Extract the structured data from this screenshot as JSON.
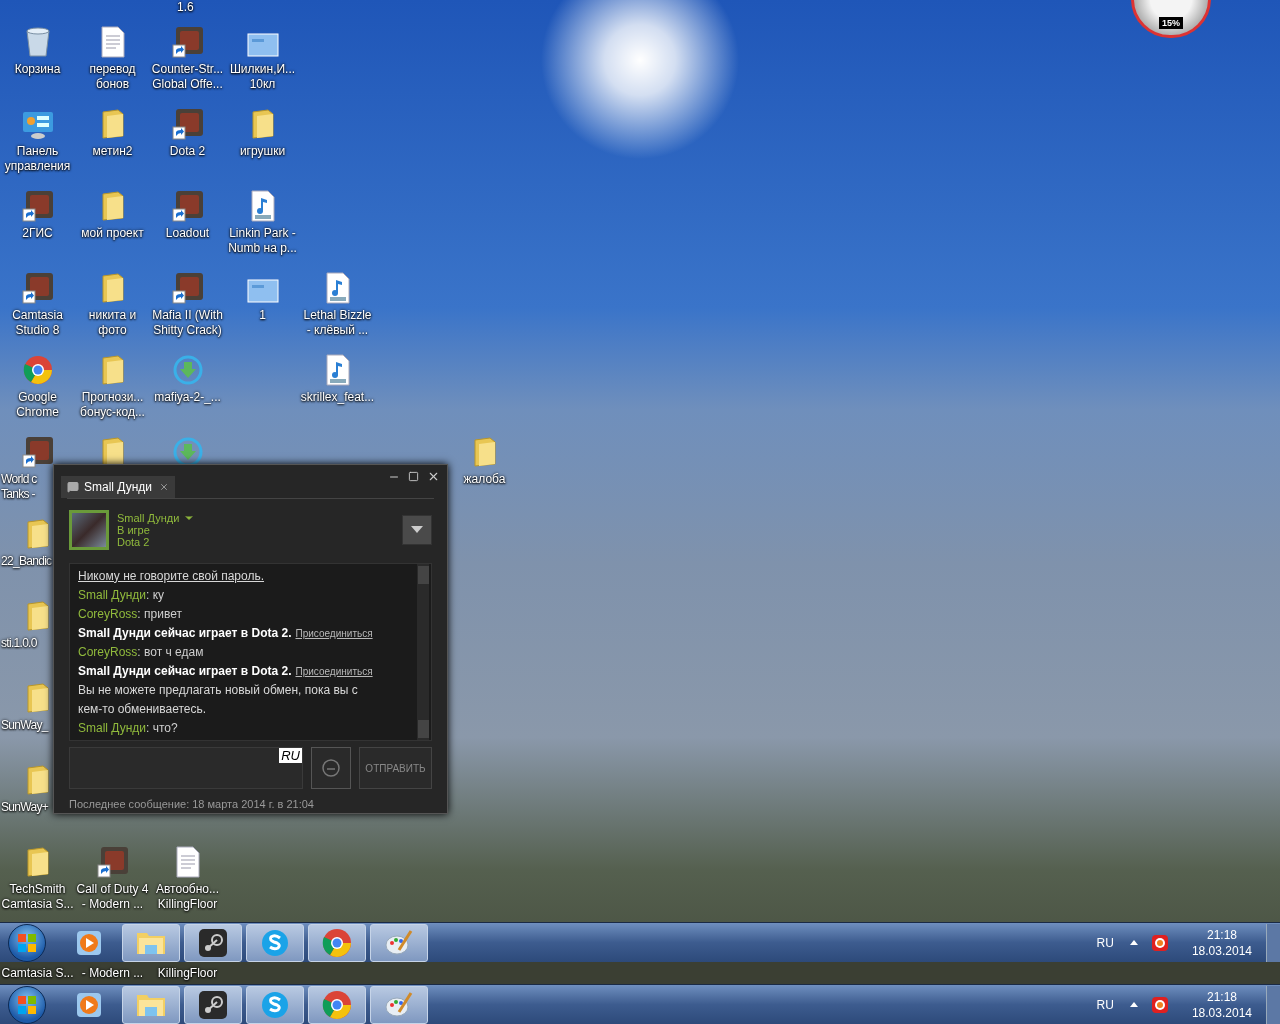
{
  "top_partial_label": "1.6",
  "gadget": {
    "reading": "15%"
  },
  "desktop_columns": [
    {
      "icons": [
        {
          "kind": "recycle",
          "lines": [
            "Корзина"
          ]
        },
        {
          "kind": "control",
          "lines": [
            "Панель",
            "управления"
          ]
        },
        {
          "kind": "app",
          "lines": [
            "2ГИС"
          ]
        },
        {
          "kind": "app",
          "lines": [
            "Camtasia",
            "Studio 8"
          ]
        },
        {
          "kind": "chrome",
          "lines": [
            "Google",
            "Chrome"
          ]
        },
        {
          "kind": "app",
          "lines": [
            "World c",
            "Tanks -"
          ]
        },
        {
          "kind": "folder",
          "lines": [
            "22_Bandic"
          ]
        },
        {
          "kind": "folder",
          "lines": [
            "sti.1.0.0"
          ]
        },
        {
          "kind": "folder",
          "lines": [
            "SunWay_"
          ]
        },
        {
          "kind": "folder",
          "lines": [
            "SunWay+"
          ]
        },
        {
          "kind": "folder",
          "lines": [
            "TechSmith",
            "Camtasia S..."
          ]
        }
      ]
    },
    {
      "icons": [
        {
          "kind": "document",
          "lines": [
            "перевод",
            "бонов"
          ]
        },
        {
          "kind": "folder",
          "lines": [
            "метин2"
          ]
        },
        {
          "kind": "folder",
          "lines": [
            "мой проект"
          ]
        },
        {
          "kind": "folder",
          "lines": [
            "никита и",
            "фото"
          ]
        },
        {
          "kind": "folder",
          "lines": [
            "Прогнози...",
            "бонус-код..."
          ]
        },
        {
          "kind": "folder"
        },
        {
          "kind": "empty"
        },
        {
          "kind": "empty"
        },
        {
          "kind": "empty"
        },
        {
          "kind": "empty"
        },
        {
          "kind": "app",
          "lines": [
            "Call of Duty 4",
            "- Modern ..."
          ]
        }
      ]
    },
    {
      "icons": [
        {
          "kind": "app",
          "lines": [
            "Counter-Str...",
            "Global Offe..."
          ]
        },
        {
          "kind": "app",
          "lines": [
            "Dota 2"
          ]
        },
        {
          "kind": "app",
          "lines": [
            "Loadout"
          ]
        },
        {
          "kind": "app",
          "lines": [
            "Mafia II (With",
            "Shitty Crack)"
          ]
        },
        {
          "kind": "download",
          "lines": [
            "mafiya-2-_..."
          ]
        },
        {
          "kind": "download"
        },
        {
          "kind": "empty"
        },
        {
          "kind": "empty"
        },
        {
          "kind": "empty"
        },
        {
          "kind": "empty"
        },
        {
          "kind": "document",
          "lines": [
            "Автообно...",
            "KillingFloor"
          ]
        }
      ]
    },
    {
      "icons": [
        {
          "kind": "image",
          "lines": [
            "Шилкин,И...",
            "10кл"
          ]
        },
        {
          "kind": "folder",
          "lines": [
            "игрушки"
          ]
        },
        {
          "kind": "mp3",
          "lines": [
            "Linkin Park -",
            "Numb на p..."
          ]
        },
        {
          "kind": "image",
          "lines": [
            "1"
          ]
        }
      ]
    },
    {
      "icons": [
        {
          "kind": "empty"
        },
        {
          "kind": "empty"
        },
        {
          "kind": "empty"
        },
        {
          "kind": "mp3",
          "lines": [
            "Lethal Bizzle",
            "- клёвый ..."
          ]
        },
        {
          "kind": "mp3",
          "lines": [
            "skrillex_feat..."
          ]
        }
      ]
    }
  ],
  "loose_icon": {
    "kind": "folder",
    "lines": [
      "жалоба"
    ]
  },
  "chat": {
    "tab": {
      "label": "Small Дунди",
      "selected": true
    },
    "friend": {
      "name": "Small Дунди",
      "status": "В игре",
      "game": "Dota 2"
    },
    "messages": [
      {
        "kind": "notice",
        "text": "Никому не говорите свой пароль."
      },
      {
        "kind": "message",
        "author": "Small Дунди",
        "text": ": ку"
      },
      {
        "kind": "message",
        "author": "CoreyRoss",
        "text": ": привет"
      },
      {
        "kind": "invite",
        "text": "Small Дунди сейчас играет в Dota 2.",
        "link": "Присоединиться"
      },
      {
        "kind": "message",
        "author": "CoreyRoss",
        "text": ": вот ч едам"
      },
      {
        "kind": "invite",
        "text": "Small Дунди сейчас играет в Dota 2.",
        "link": "Присоединиться"
      },
      {
        "kind": "system",
        "text": "Вы не можете предлагать новый обмен, пока вы с кем-то обмениваетесь."
      },
      {
        "kind": "message",
        "author": "Small Дунди",
        "text": ": что?"
      }
    ],
    "input_lang": "RU",
    "send": "ОТПРАВИТЬ",
    "footer": "Последнее сообщение: 18 марта 2014 г. в 21:04"
  },
  "taskbars": [
    {
      "apps": [
        {
          "kind": "media",
          "running": false
        },
        {
          "kind": "explorer",
          "running": true
        },
        {
          "kind": "steam",
          "running": true
        },
        {
          "kind": "skype",
          "running": true
        },
        {
          "kind": "chrome",
          "running": true
        },
        {
          "kind": "paint",
          "running": true
        }
      ],
      "lang": "RU",
      "time": "21:18",
      "date": "18.03.2014"
    },
    {
      "apps": [
        {
          "kind": "media",
          "running": false
        },
        {
          "kind": "explorer",
          "running": true
        },
        {
          "kind": "steam",
          "running": true
        },
        {
          "kind": "skype",
          "running": true
        },
        {
          "kind": "chrome",
          "running": true
        },
        {
          "kind": "paint",
          "running": true
        }
      ],
      "lang": "RU",
      "time": "21:18",
      "date": "18.03.2014"
    }
  ],
  "ghost_labels": [
    "Camtasia S...",
    "- Modern ...",
    "KillingFloor"
  ]
}
